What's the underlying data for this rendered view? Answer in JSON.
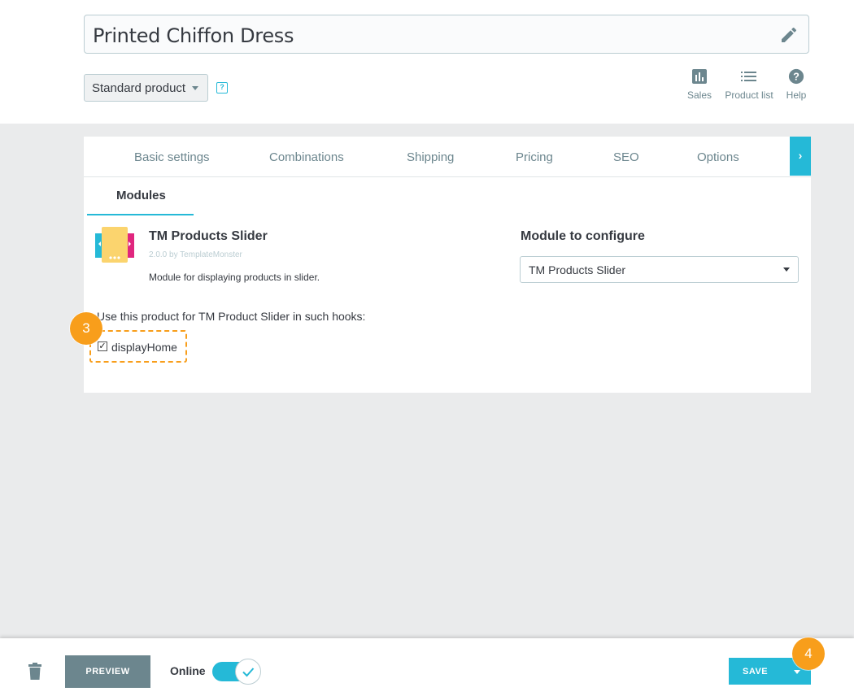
{
  "product": {
    "name": "Printed Chiffon Dress",
    "type": "Standard product",
    "help_glyph": "?"
  },
  "quick_links": [
    {
      "label": "Sales",
      "icon": "bar-chart-icon"
    },
    {
      "label": "Product list",
      "icon": "list-icon"
    },
    {
      "label": "Help",
      "icon": "help-circle-icon"
    }
  ],
  "tabs": {
    "items": [
      "Basic settings",
      "Combinations",
      "Shipping",
      "Pricing",
      "SEO",
      "Options"
    ],
    "next_glyph": "›",
    "active": "Modules"
  },
  "module": {
    "name": "TM Products Slider",
    "version": "2.0.0 by TemplateMonster",
    "description": "Module for displaying products in slider.",
    "config_label": "Module to configure",
    "config_value": "TM Products Slider",
    "hooks_label": "Use this product for TM Product Slider in such hooks:",
    "hook": {
      "label": "displayHome",
      "checked": true
    }
  },
  "badges": {
    "step3": "3",
    "step4": "4"
  },
  "footer": {
    "preview": "PREVIEW",
    "online_label": "Online",
    "online": true,
    "save": "SAVE"
  },
  "colors": {
    "accent": "#25b9d7",
    "highlight": "#f89e1b",
    "secondary": "#6c868e",
    "background": "#eaebec"
  }
}
